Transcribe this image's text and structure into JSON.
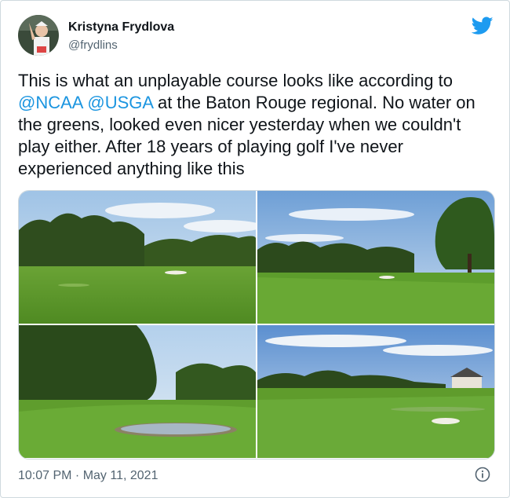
{
  "author": {
    "display_name": "Kristyna Frydlova",
    "handle": "@frydlins"
  },
  "tweet": {
    "text_part1": "This is what an unplayable course looks like according to ",
    "mention1": "@NCAA",
    "between": " ",
    "mention2": "@USGA",
    "text_part2": " at the Baton Rouge regional. No water on the greens, looked even nicer yesterday when we couldn't play either. After 18 years of playing golf I've never experienced anything like this"
  },
  "meta": {
    "time": "10:07 PM",
    "separator": " · ",
    "date": "May 11, 2021"
  },
  "icons": {
    "brand": "twitter-bird-icon",
    "info": "info-icon"
  },
  "colors": {
    "brand": "#1d9bf0",
    "mention": "#1b95e0",
    "secondary_text": "#536471"
  }
}
